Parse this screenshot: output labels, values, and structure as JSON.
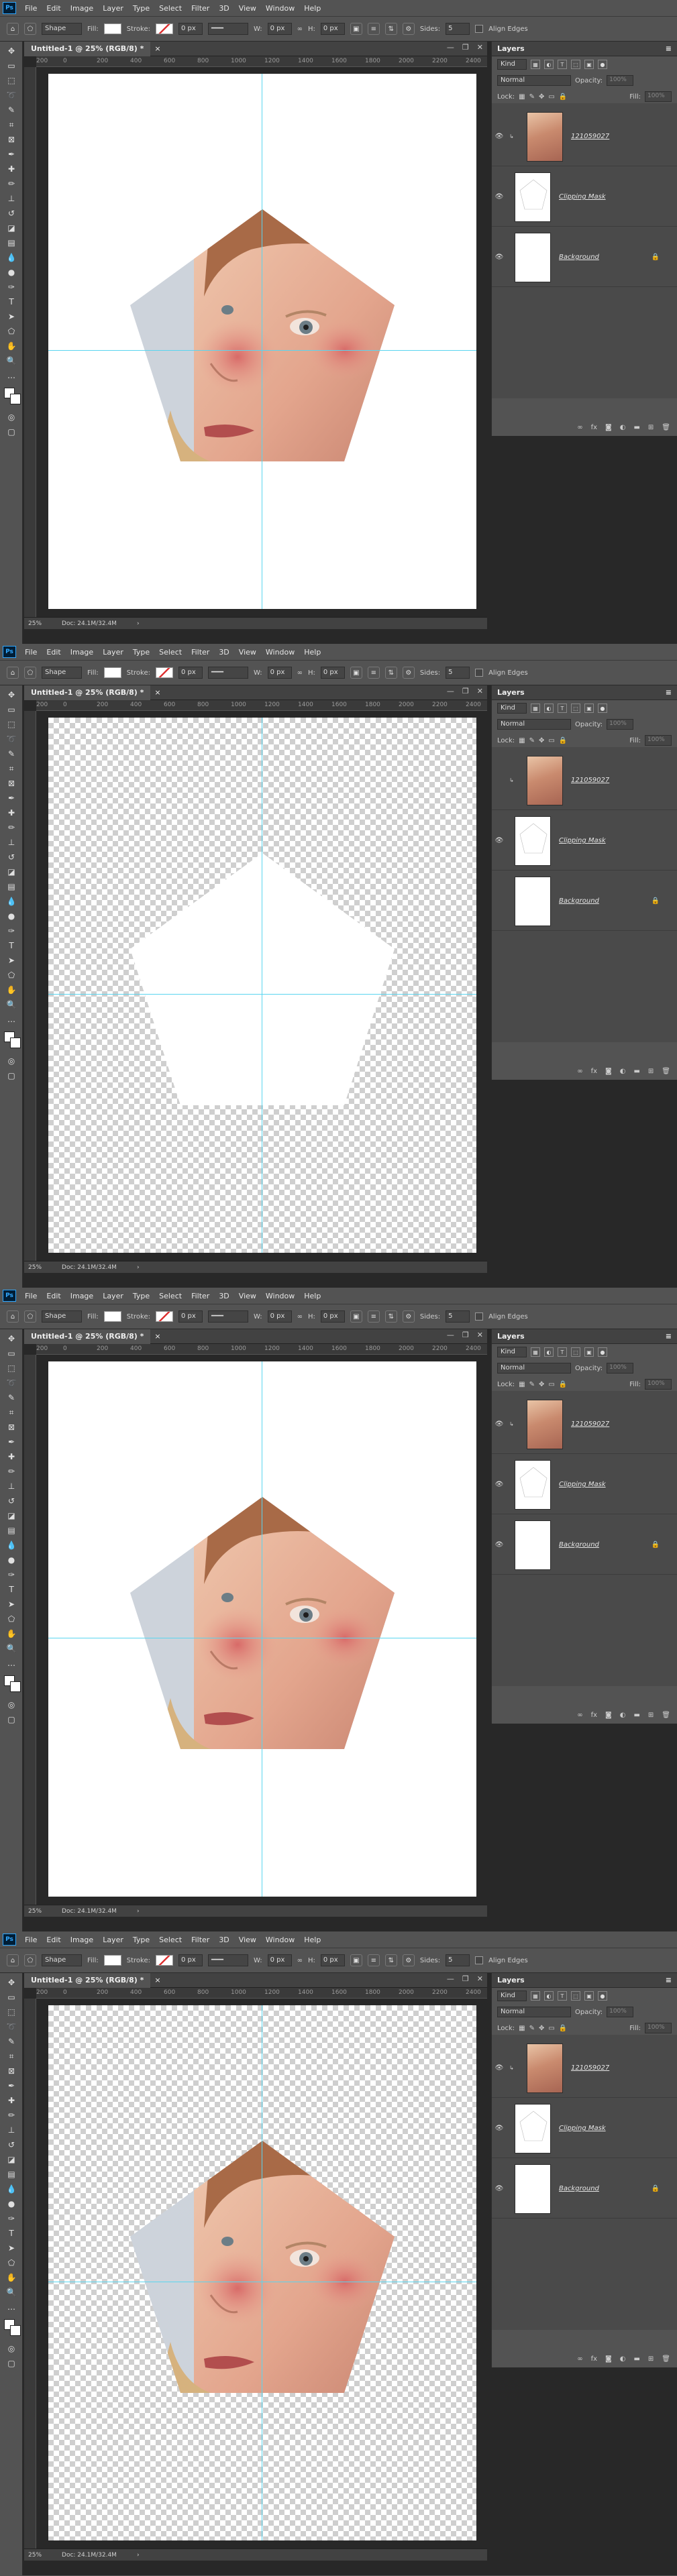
{
  "app": {
    "logo": "Ps"
  },
  "menu": [
    "File",
    "Edit",
    "Image",
    "Layer",
    "Type",
    "Select",
    "Filter",
    "3D",
    "View",
    "Window",
    "Help"
  ],
  "options_bar": {
    "mode": "Shape",
    "fill_label": "Fill:",
    "stroke_label": "Stroke:",
    "stroke_size": "0 px",
    "w_label": "W:",
    "w_value": "0 px",
    "h_label": "H:",
    "h_value": "0 px",
    "sides_label": "Sides:",
    "sides_value": "5",
    "align_edges_label": "Align Edges"
  },
  "document": {
    "tab_title": "Untitled-1 @ 25% (RGB/8) *",
    "zoom": "25%",
    "doc_size": "Doc: 24.1M/32.4M",
    "ruler_ticks": [
      "200",
      "0",
      "200",
      "400",
      "600",
      "800",
      "1000",
      "1200",
      "1400",
      "1600",
      "1800",
      "2000",
      "2200",
      "2400"
    ]
  },
  "layers_panel": {
    "title": "Layers",
    "filter_kind": "Kind",
    "blend_mode": "Normal",
    "opacity_label": "Opacity:",
    "opacity_value": "100%",
    "lock_label": "Lock:",
    "fill_label": "Fill:",
    "fill_value": "100%",
    "layers": [
      {
        "name": "121059027"
      },
      {
        "name": "Clipping Mask"
      },
      {
        "name": "Background"
      }
    ]
  },
  "frames": [
    {
      "canvas": "white",
      "photo_visible": true
    },
    {
      "canvas": "checker",
      "photo_visible": false
    },
    {
      "canvas": "white",
      "photo_visible": true
    },
    {
      "canvas": "checker",
      "photo_visible": true
    }
  ]
}
